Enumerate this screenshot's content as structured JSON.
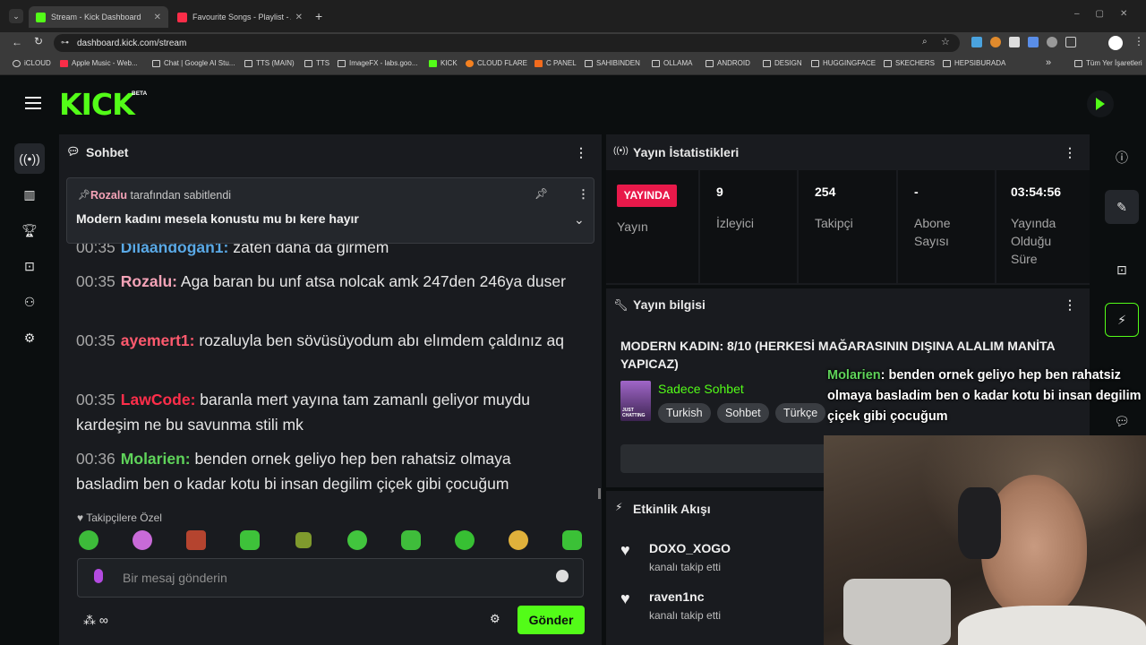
{
  "browser": {
    "tabs": [
      {
        "title": "Stream - Kick Dashboard",
        "active": true
      },
      {
        "title": "Favourite Songs - Playlist - App",
        "active": false
      }
    ],
    "url": "dashboard.kick.com/stream",
    "bookmarks": [
      "iCLOUD",
      "Apple Music - Web...",
      "Chat | Google AI Stu...",
      "TTS (MAIN)",
      "TTS",
      "ImageFX - labs.goo...",
      "KICK",
      "CLOUD FLARE",
      "C PANEL",
      "SAHIBINDEN",
      "OLLAMA",
      "ANDROID",
      "DESIGN",
      "HUGGINGFACE",
      "SKECHERS",
      "HEPSIBURADA"
    ],
    "all_bookmarks": "Tüm Yer İşaretleri",
    "more": "»"
  },
  "kick": {
    "logo": "KICK",
    "beta": "BETA",
    "accent": "#53fc18"
  },
  "chat": {
    "title": "Sohbet",
    "pinned": {
      "user": "Rozalu",
      "suffix": "tarafından sabitlendi",
      "message": "Modern kadını mesela konustu mu bı kere hayır"
    },
    "partial_top": {
      "time": "00:35",
      "user": "Dilaandogan1:",
      "text": "zaten daha da girmem"
    },
    "messages": [
      {
        "time": "00:35",
        "user": "Rozalu:",
        "color": "#f4a3b7",
        "text": "Aga baran bu unf atsa nolcak amk 247den 246ya duser"
      },
      {
        "time": "00:35",
        "user": "ayemert1:",
        "color": "#ff5a6e",
        "text": "rozaluyla ben sövüsüyodum abı elımdem çaldınız aq"
      },
      {
        "time": "00:35",
        "user": "LawCode:",
        "color": "#ff2e4a",
        "text": "baranla mert yayına tam zamanlı geliyor muydu kardeşim ne bu savunma stili mk"
      },
      {
        "time": "00:36",
        "user": "Molarien:",
        "color": "#5fd35a",
        "text": "benden ornek geliyo hep ben rahatsiz olmaya basladim ben o kadar kotu bi insan degilim çiçek gibi çocuğum"
      }
    ],
    "followers_only": "Takipçilere Özel",
    "input_placeholder": "Bir mesaj gönderin",
    "send": "Gönder"
  },
  "stats": {
    "title": "Yayın İstatistikleri",
    "live_badge": "YAYINDA",
    "live_label": "Yayın",
    "viewers": {
      "value": "9",
      "label": "İzleyici"
    },
    "followers": {
      "value": "254",
      "label": "Takipçi"
    },
    "subs": {
      "value": "-",
      "label": "Abone Sayısı"
    },
    "uptime": {
      "value": "03:54:56",
      "label": "Yayında Olduğu Süre"
    }
  },
  "info": {
    "title": "Yayın bilgisi",
    "stream_title": "MODERN KADIN: 8/10 (HERKESİ MAĞARASININ DIŞINA ALALIM MANİTA YAPICAZ)",
    "category": "Sadece Sohbet",
    "thumb_text": "JUST CHATTING",
    "tags": [
      "Turkish",
      "Sohbet",
      "Türkçe"
    ]
  },
  "activity": {
    "title": "Etkinlik Akışı",
    "items": [
      {
        "user": "DOXO_XOGO",
        "action": "kanalı takip etti"
      },
      {
        "user": "raven1nc",
        "action": "kanalı takip etti"
      }
    ]
  },
  "overlay": {
    "user": "Molarien",
    "text": ": benden ornek geliyo hep ben rahatsiz olmaya basladim ben o kadar kotu bi insan degilim çiçek gibi çocuğum"
  }
}
